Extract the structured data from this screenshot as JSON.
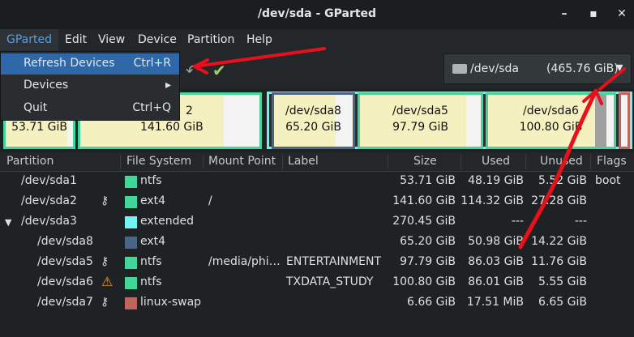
{
  "window": {
    "title": "/dev/sda - GParted"
  },
  "menubar": [
    "GParted",
    "Edit",
    "View",
    "Device",
    "Partition",
    "Help"
  ],
  "gparted_menu": [
    {
      "label": "Refresh Devices",
      "accel": "Ctrl+R"
    },
    {
      "label": "Devices",
      "accel": "▸"
    },
    {
      "label": "Quit",
      "accel": "Ctrl+Q"
    }
  ],
  "device_selector": {
    "name": "/dev/sda",
    "size": "(465.76 GiB)"
  },
  "partition_map": {
    "sda1": {
      "size": "53.71 GiB"
    },
    "sda2": {
      "name_partial": "2",
      "size": "141.60 GiB"
    },
    "sda8": {
      "name": "/dev/sda8",
      "size": "65.20 GiB"
    },
    "sda5": {
      "name": "/dev/sda5",
      "size": "97.79 GiB"
    },
    "sda6": {
      "name": "/dev/sda6",
      "size": "100.80 GiB"
    }
  },
  "columns": [
    "Partition",
    "File System",
    "Mount Point",
    "Label",
    "Size",
    "Used",
    "Unused",
    "Flags"
  ],
  "rows": [
    {
      "partition": "/dev/sda1",
      "fs": "ntfs",
      "mount": "",
      "label": "",
      "size": "53.71 GiB",
      "used": "48.19 GiB",
      "unused": "5.52 GiB",
      "flags": "boot",
      "color": "#42d69a",
      "icon": ""
    },
    {
      "partition": "/dev/sda2",
      "fs": "ext4",
      "mount": "/",
      "label": "",
      "size": "141.60 GiB",
      "used": "114.32 GiB",
      "unused": "27.28 GiB",
      "flags": "",
      "color": "#42d69a",
      "icon": "key-icon"
    },
    {
      "partition": "/dev/sda3",
      "fs": "extended",
      "mount": "",
      "label": "",
      "size": "270.45 GiB",
      "used": "---",
      "unused": "---",
      "flags": "",
      "color": "#72f4f2",
      "icon": ""
    },
    {
      "partition": "/dev/sda8",
      "fs": "ext4",
      "mount": "",
      "label": "",
      "size": "65.20 GiB",
      "used": "50.98 GiB",
      "unused": "14.22 GiB",
      "flags": "",
      "color": "#4b6584",
      "icon": ""
    },
    {
      "partition": "/dev/sda5",
      "fs": "ntfs",
      "mount": "/media/phi…",
      "label": "ENTERTAINMENT",
      "size": "97.79 GiB",
      "used": "86.03 GiB",
      "unused": "11.76 GiB",
      "flags": "",
      "color": "#42d69a",
      "icon": "key-icon"
    },
    {
      "partition": "/dev/sda6",
      "fs": "ntfs",
      "mount": "",
      "label": "TXDATA_STUDY",
      "size": "100.80 GiB",
      "used": "86.01 GiB",
      "unused": "5.55 GiB",
      "flags": "",
      "color": "#42d69a",
      "icon": "warning-icon"
    },
    {
      "partition": "/dev/sda7",
      "fs": "linux-swap",
      "mount": "",
      "label": "",
      "size": "6.66 GiB",
      "used": "17.51 MiB",
      "unused": "6.65 GiB",
      "flags": "",
      "color": "#c0645c",
      "icon": "key-icon"
    }
  ]
}
